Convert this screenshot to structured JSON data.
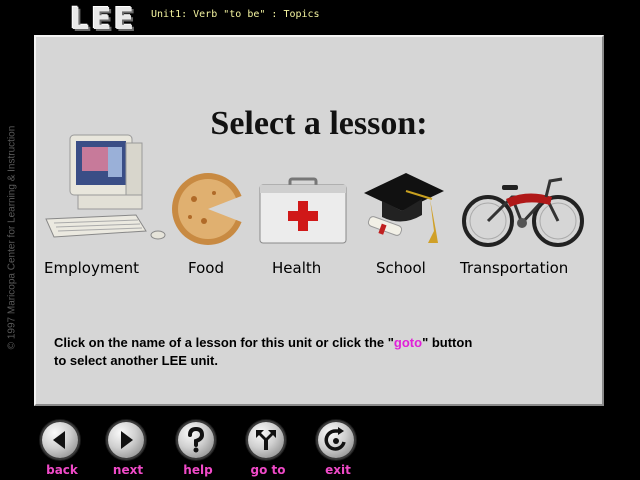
{
  "header": {
    "logo": "LEE",
    "unit_title": "Unit1: Verb \"to be\" : Topics"
  },
  "copyright": "© 1997 Maricopa Center for Learning & Instruction",
  "panel": {
    "title": "Select a lesson:",
    "lessons": [
      {
        "label": "Employment",
        "icon": "computer-icon"
      },
      {
        "label": "Food",
        "icon": "pie-icon"
      },
      {
        "label": "Health",
        "icon": "first-aid-kit-icon"
      },
      {
        "label": "School",
        "icon": "graduation-cap-icon"
      },
      {
        "label": "Transportation",
        "icon": "bicycle-icon"
      }
    ],
    "instructions": {
      "part1": "Click on the name of a lesson for this unit or click the \"",
      "goto": "goto",
      "part2": "\" button",
      "line2": "to select another  LEE unit."
    }
  },
  "nav": [
    {
      "label": "back",
      "icon": "arrow-left-icon"
    },
    {
      "label": "next",
      "icon": "arrow-right-icon"
    },
    {
      "label": "help",
      "icon": "question-mark-icon"
    },
    {
      "label": "go to",
      "icon": "goto-arrows-icon"
    },
    {
      "label": "exit",
      "icon": "exit-swirl-icon"
    }
  ],
  "colors": {
    "background": "#000000",
    "panel": "#d6d6d6",
    "nav_label": "#f04ac8",
    "goto_highlight": "#e020d8",
    "unit_title": "#f4f4a0"
  }
}
